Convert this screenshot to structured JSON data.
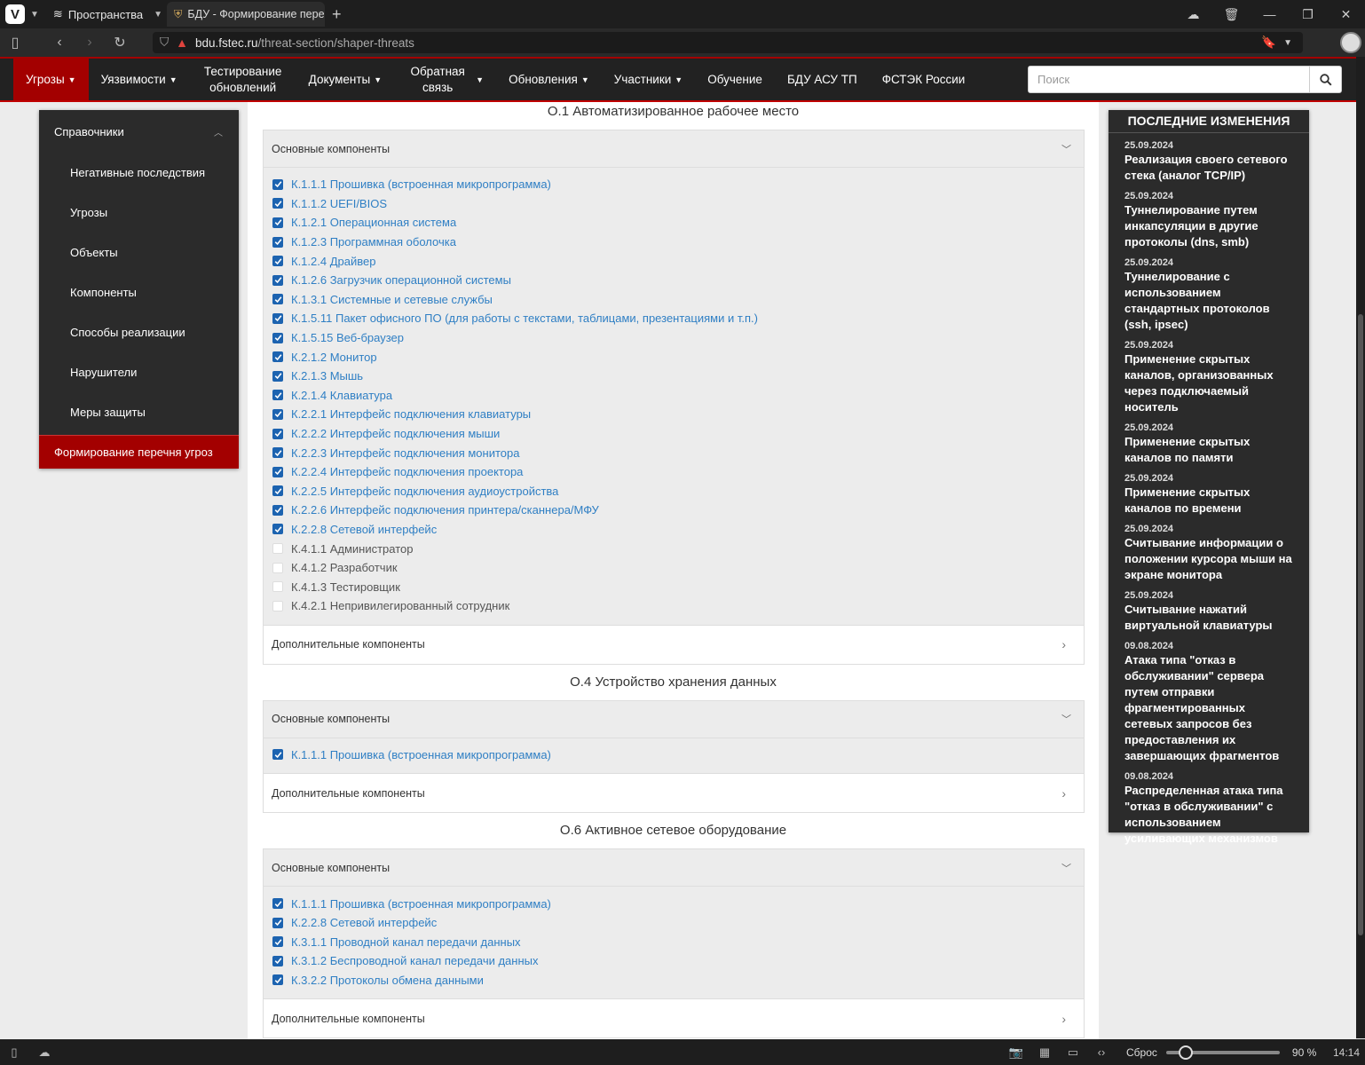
{
  "browser": {
    "spaces_label": "Пространства",
    "tab_title": "БДУ - Формирование пере",
    "url_host": "bdu.fstec.ru",
    "url_path": "/threat-section/shaper-threats",
    "status": {
      "reset_label": "Сброс",
      "zoom": "90 %",
      "time": "14:14"
    }
  },
  "nav": {
    "items": [
      {
        "label": "Угрозы"
      },
      {
        "label": "Уязвимости"
      },
      {
        "label": "Тестирование обновлений"
      },
      {
        "label": "Документы"
      },
      {
        "label": "Обратная связь"
      },
      {
        "label": "Обновления"
      },
      {
        "label": "Участники"
      },
      {
        "label": "Обучение"
      },
      {
        "label": "БДУ АСУ ТП"
      },
      {
        "label": "ФСТЭК России"
      }
    ],
    "search_placeholder": "Поиск"
  },
  "sidebar": {
    "header": "Справочники",
    "items": [
      "Негативные последствия",
      "Угрозы",
      "Объекты",
      "Компоненты",
      "Способы реализации",
      "Нарушители",
      "Меры защиты"
    ],
    "active": "Формирование перечня угроз"
  },
  "sections": [
    {
      "title": "О.1 Автоматизированное рабочее место",
      "main_label": "Основные компоненты",
      "extra_label": "Дополнительные компоненты",
      "items": [
        {
          "label": "К.1.1.1 Прошивка (встроенная микропрограмма)",
          "checked": true
        },
        {
          "label": "К.1.1.2 UEFI/BIOS",
          "checked": true
        },
        {
          "label": "К.1.2.1 Операционная система",
          "checked": true
        },
        {
          "label": "К.1.2.3 Программная оболочка",
          "checked": true
        },
        {
          "label": "К.1.2.4 Драйвер",
          "checked": true
        },
        {
          "label": "К.1.2.6 Загрузчик операционной системы",
          "checked": true
        },
        {
          "label": "К.1.3.1 Системные и сетевые службы",
          "checked": true
        },
        {
          "label": "К.1.5.11 Пакет офисного ПО (для работы с текстами, таблицами, презентациями и т.п.)",
          "checked": true
        },
        {
          "label": "К.1.5.15 Веб-браузер",
          "checked": true
        },
        {
          "label": "К.2.1.2 Монитор",
          "checked": true
        },
        {
          "label": "К.2.1.3 Мышь",
          "checked": true
        },
        {
          "label": "К.2.1.4 Клавиатура",
          "checked": true
        },
        {
          "label": "К.2.2.1 Интерфейс подключения клавиатуры",
          "checked": true
        },
        {
          "label": "К.2.2.2 Интерфейс подключения мыши",
          "checked": true
        },
        {
          "label": "К.2.2.3 Интерфейс подключения монитора",
          "checked": true
        },
        {
          "label": "К.2.2.4 Интерфейс подключения проектора",
          "checked": true
        },
        {
          "label": "К.2.2.5 Интерфейс подключения аудиоустройства",
          "checked": true
        },
        {
          "label": "К.2.2.6 Интерфейс подключения принтера/сканнера/МФУ",
          "checked": true
        },
        {
          "label": "К.2.2.8 Сетевой интерфейс",
          "checked": true
        },
        {
          "label": "К.4.1.1 Администратор",
          "checked": false
        },
        {
          "label": "К.4.1.2 Разработчик",
          "checked": false
        },
        {
          "label": "К.4.1.3 Тестировщик",
          "checked": false
        },
        {
          "label": "К.4.2.1 Непривилегированный сотрудник",
          "checked": false
        }
      ]
    },
    {
      "title": "О.4 Устройство хранения данных",
      "main_label": "Основные компоненты",
      "extra_label": "Дополнительные компоненты",
      "items": [
        {
          "label": "К.1.1.1 Прошивка (встроенная микропрограмма)",
          "checked": true
        }
      ]
    },
    {
      "title": "О.6 Активное сетевое оборудование",
      "main_label": "Основные компоненты",
      "extra_label": "Дополнительные компоненты",
      "items": [
        {
          "label": "К.1.1.1 Прошивка (встроенная микропрограмма)",
          "checked": true
        },
        {
          "label": "К.2.2.8 Сетевой интерфейс",
          "checked": true
        },
        {
          "label": "К.3.1.1 Проводной канал передачи данных",
          "checked": true
        },
        {
          "label": "К.3.1.2 Беспроводной канал передачи данных",
          "checked": true
        },
        {
          "label": "К.3.2.2 Протоколы обмена данными",
          "checked": true
        }
      ]
    }
  ],
  "news": {
    "title": "ПОСЛЕДНИЕ ИЗМЕНЕНИЯ",
    "items": [
      {
        "date": "25.09.2024",
        "title": "Реализация своего сетевого стека (аналог TCP/IP)"
      },
      {
        "date": "25.09.2024",
        "title": "Туннелирование путем инкапсуляции в другие протоколы (dns, smb)"
      },
      {
        "date": "25.09.2024",
        "title": "Туннелирование с использованием стандартных протоколов (ssh, ipsec)"
      },
      {
        "date": "25.09.2024",
        "title": "Применение скрытых каналов, организованных через подключаемый носитель"
      },
      {
        "date": "25.09.2024",
        "title": "Применение скрытых каналов по памяти"
      },
      {
        "date": "25.09.2024",
        "title": "Применение скрытых каналов по времени"
      },
      {
        "date": "25.09.2024",
        "title": "Считывание информации о положении курсора мыши на экране монитора"
      },
      {
        "date": "25.09.2024",
        "title": "Считывание нажатий виртуальной клавиатуры"
      },
      {
        "date": "09.08.2024",
        "title": "Атака типа \"отказ в обслуживании\" сервера путем отправки фрагментированных сетевых запросов без предоставления их завершающих фрагментов"
      },
      {
        "date": "09.08.2024",
        "title": "Распределенная атака типа \"отказ в обслуживании\" с использованием усиливающих механизмов"
      }
    ]
  },
  "colors": {
    "accent": "#a30000",
    "link": "#2f7fc4",
    "checkbox": "#1c63b0"
  }
}
